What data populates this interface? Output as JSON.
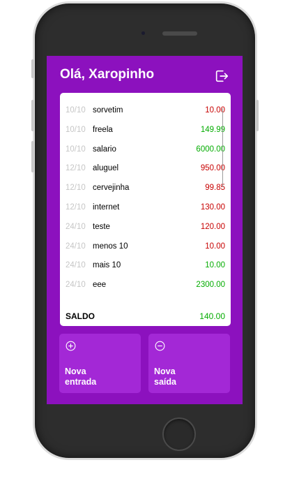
{
  "header": {
    "greeting": "Olá, Xaropinho"
  },
  "icons": {
    "logout": "logout-icon",
    "add": "plus-circle-icon",
    "remove": "minus-circle-icon"
  },
  "transactions": [
    {
      "date": "10/10",
      "description": "sorvetim",
      "value": "10.00",
      "type": "out"
    },
    {
      "date": "10/10",
      "description": "freela",
      "value": "149.99",
      "type": "in"
    },
    {
      "date": "10/10",
      "description": "salario",
      "value": "6000.00",
      "type": "in"
    },
    {
      "date": "12/10",
      "description": "aluguel",
      "value": "950.00",
      "type": "out"
    },
    {
      "date": "12/10",
      "description": "cervejinha",
      "value": "99.85",
      "type": "out"
    },
    {
      "date": "12/10",
      "description": "internet",
      "value": "130.00",
      "type": "out"
    },
    {
      "date": "24/10",
      "description": "teste",
      "value": "120.00",
      "type": "out"
    },
    {
      "date": "24/10",
      "description": "menos 10",
      "value": "10.00",
      "type": "out"
    },
    {
      "date": "24/10",
      "description": "mais 10",
      "value": "10.00",
      "type": "in"
    },
    {
      "date": "24/10",
      "description": "eee",
      "value": "2300.00",
      "type": "in"
    }
  ],
  "balance": {
    "label": "SALDO",
    "value": "140.00",
    "type": "in"
  },
  "actions": {
    "new_entry_line1": "Nova",
    "new_entry_line2": "entrada",
    "new_exit_line1": "Nova",
    "new_exit_line2": "saída"
  },
  "colors": {
    "background": "#8c11be",
    "button": "#a328d6",
    "negative": "#c70000",
    "positive": "#03ac00"
  }
}
